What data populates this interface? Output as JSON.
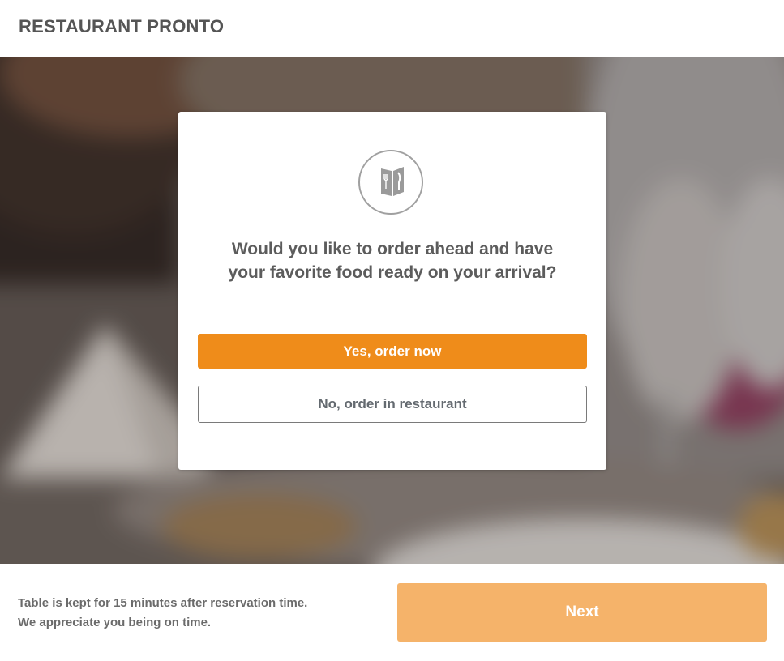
{
  "header": {
    "brand": "RESTAURANT PRONTO"
  },
  "modal": {
    "icon": "menu-book-icon",
    "question_line1": "Would you like to order ahead and have",
    "question_line2": "your favorite food ready on your arrival?",
    "yes_label": "Yes, order now",
    "no_label": "No, order in restaurant"
  },
  "footer": {
    "note_line1": "Table is kept for 15 minutes after reservation time.",
    "note_line2": "We appreciate you being on time.",
    "next_label": "Next"
  },
  "colors": {
    "accent": "#ef8c1a",
    "accent_disabled": "#f5b36a",
    "brand_text": "#555555"
  }
}
